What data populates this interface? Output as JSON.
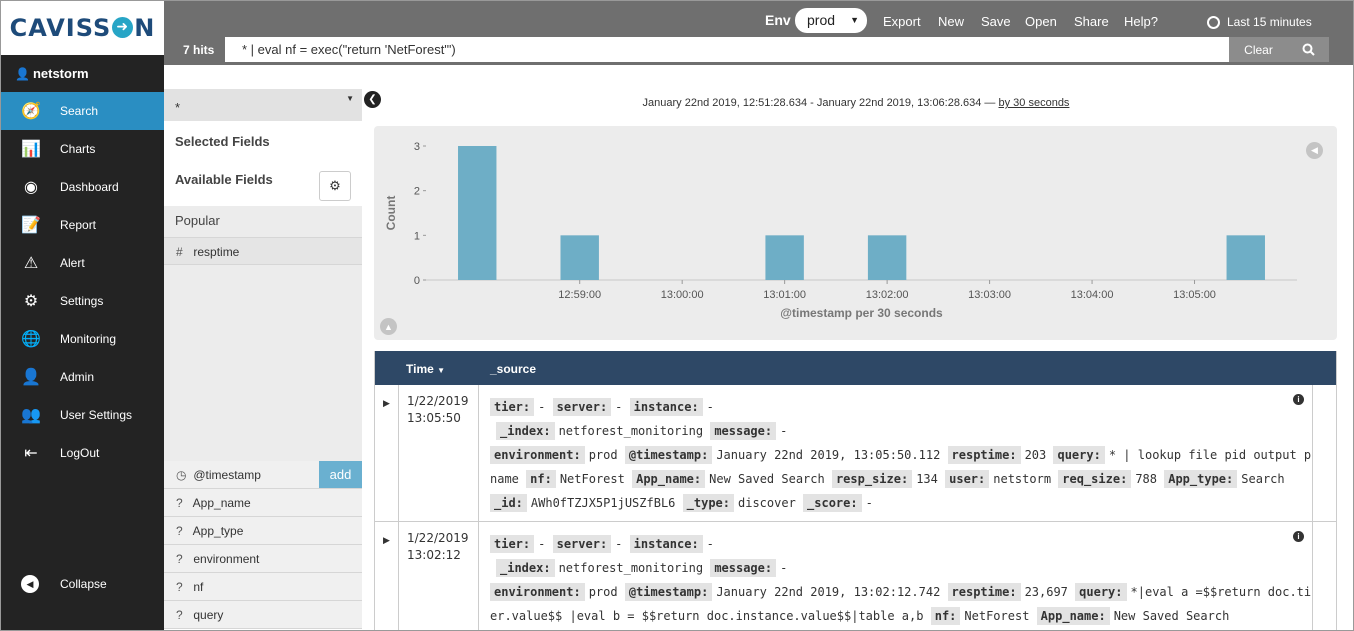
{
  "brand": {
    "logo_before": "CAVISS",
    "logo_after": "N"
  },
  "user": {
    "name": "netstorm"
  },
  "nav": {
    "items": [
      {
        "label": "Search",
        "icon": "compass-icon",
        "active": true
      },
      {
        "label": "Charts",
        "icon": "bar-chart-icon"
      },
      {
        "label": "Dashboard",
        "icon": "dashboard-icon"
      },
      {
        "label": "Report",
        "icon": "report-icon"
      },
      {
        "label": "Alert",
        "icon": "warning-icon"
      },
      {
        "label": "Settings",
        "icon": "gear-icon"
      },
      {
        "label": "Monitoring",
        "icon": "globe-icon"
      },
      {
        "label": "Admin",
        "icon": "user-icon"
      },
      {
        "label": "User Settings",
        "icon": "user-gear-icon"
      },
      {
        "label": "LogOut",
        "icon": "logout-icon"
      }
    ],
    "collapse": "Collapse"
  },
  "topbar": {
    "env_label": "Env",
    "env_value": "prod",
    "links": [
      "Export",
      "New",
      "Save",
      "Open",
      "Share",
      "Help?"
    ],
    "time_range": "Last 15 minutes",
    "hits": "7 hits",
    "query": "* | eval nf = exec(\"return 'NetForest'\")",
    "clear": "Clear"
  },
  "fields": {
    "index": "*",
    "selected_title": "Selected Fields",
    "available_title": "Available Fields",
    "popular_title": "Popular",
    "popular": [
      {
        "type": "#",
        "name": "resptime"
      }
    ],
    "timestamp": {
      "name": "@timestamp",
      "add": "add"
    },
    "list": [
      {
        "type": "?",
        "name": "App_name"
      },
      {
        "type": "?",
        "name": "App_type"
      },
      {
        "type": "?",
        "name": "environment"
      },
      {
        "type": "?",
        "name": "nf"
      },
      {
        "type": "?",
        "name": "query"
      }
    ]
  },
  "range": {
    "text": "January 22nd 2019, 12:51:28.634 - January 22nd 2019, 13:06:28.634 —",
    "interval": "by 30 seconds"
  },
  "chart_data": {
    "type": "bar",
    "ylabel": "Count",
    "xlabel": "@timestamp per 30 seconds",
    "ylim": [
      0,
      3
    ],
    "yticks": [
      0,
      1,
      2,
      3
    ],
    "xticks": [
      "12:59:00",
      "13:00:00",
      "13:01:00",
      "13:02:00",
      "13:03:00",
      "13:04:00",
      "13:05:00"
    ],
    "bucket_seconds": 30,
    "buckets": [
      {
        "time": "12:58:00",
        "count": 3
      },
      {
        "time": "12:59:00",
        "count": 1
      },
      {
        "time": "13:01:00",
        "count": 1
      },
      {
        "time": "13:02:00",
        "count": 1
      },
      {
        "time": "13:05:30",
        "count": 1
      }
    ]
  },
  "table": {
    "time_header": "Time",
    "source_header": "_source",
    "rows": [
      {
        "date": "1/22/2019",
        "time": "13:05:50",
        "lines": [
          [
            [
              "tier:",
              "-"
            ],
            [
              "server:",
              "-"
            ],
            [
              "instance:",
              "-"
            ]
          ],
          [
            [
              "_index:",
              "netforest_monitoring"
            ],
            [
              "message:",
              "-"
            ]
          ],
          [
            [
              "environment:",
              "prod"
            ],
            [
              "@timestamp:",
              "January 22nd 2019, 13:05:50.112"
            ],
            [
              "resptime:",
              "203"
            ],
            [
              "query:",
              "* | lookup file pid output p"
            ]
          ],
          [
            [
              "",
              "name"
            ],
            [
              "nf:",
              "NetForest"
            ],
            [
              "App_name:",
              "New Saved Search"
            ],
            [
              "resp_size:",
              "134"
            ],
            [
              "user:",
              "netstorm"
            ],
            [
              "req_size:",
              "788"
            ],
            [
              "App_type:",
              "Search"
            ]
          ],
          [
            [
              "_id:",
              "AWh0fTZJX5P1jUSZfBL6"
            ],
            [
              "_type:",
              "discover"
            ],
            [
              "_score:",
              "-"
            ]
          ]
        ]
      },
      {
        "date": "1/22/2019",
        "time": "13:02:12",
        "lines": [
          [
            [
              "tier:",
              "-"
            ],
            [
              "server:",
              "-"
            ],
            [
              "instance:",
              "-"
            ]
          ],
          [
            [
              "_index:",
              "netforest_monitoring"
            ],
            [
              "message:",
              "-"
            ]
          ],
          [
            [
              "environment:",
              "prod"
            ],
            [
              "@timestamp:",
              "January 22nd 2019, 13:02:12.742"
            ],
            [
              "resptime:",
              "23,697"
            ],
            [
              "query:",
              "*|eval a =$$return doc.ti"
            ]
          ],
          [
            [
              "",
              "er.value$$ |eval b = $$return doc.instance.value$$|table a,b"
            ],
            [
              "nf:",
              "NetForest"
            ],
            [
              "App_name:",
              "New Saved Search"
            ]
          ]
        ]
      }
    ]
  }
}
